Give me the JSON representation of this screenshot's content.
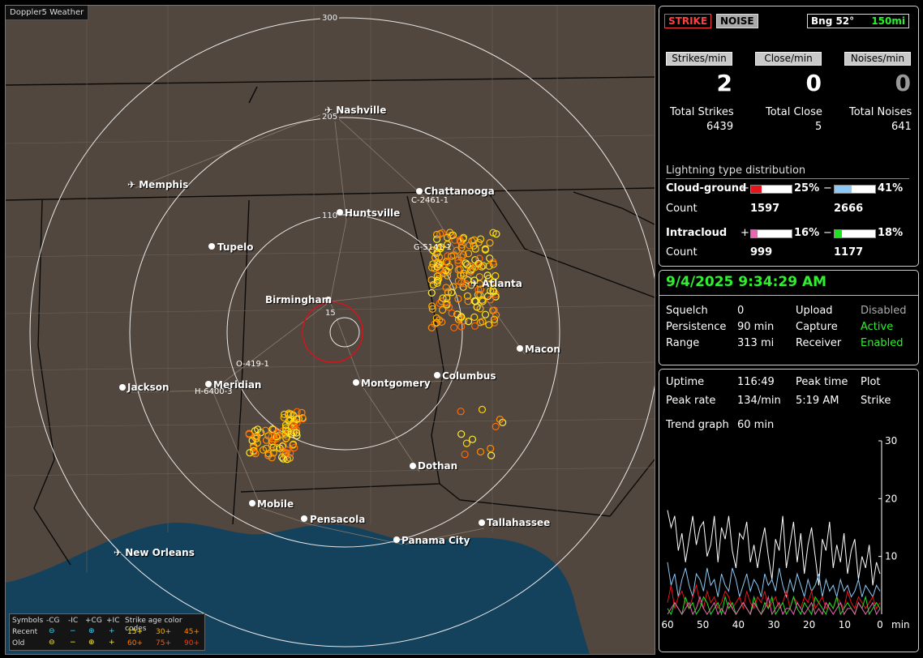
{
  "app_title": "Doppler5 Weather",
  "map": {
    "range_labels": [
      "300",
      "205",
      "110",
      "15"
    ],
    "cities": [
      "Nashville",
      "Memphis",
      "Chattanooga",
      "Huntsville",
      "Tupelo",
      "Atlanta",
      "Birmingham",
      "Macon",
      "Jackson",
      "Meridian",
      "Montgomery",
      "Columbus",
      "Dothan",
      "Mobile",
      "Pensacola",
      "Tallahassee",
      "Panama City",
      "New Orleans"
    ],
    "storm_labels": [
      "C-2461-1",
      "G-5141-1",
      "O-419-1",
      "H-6400-3"
    ]
  },
  "legend": {
    "symbols_title": "Symbols",
    "columns": [
      "-CG",
      "-IC",
      "+CG",
      "+IC"
    ],
    "recent_label": "Recent",
    "old_label": "Old",
    "age_title": "Strike age color codes",
    "recent_ages": [
      "15+",
      "30+",
      "45+"
    ],
    "old_ages": [
      "60+",
      "75+",
      "90+"
    ]
  },
  "status": {
    "strike_tab": "STRIKE",
    "noise_tab": "NOISE",
    "bearing": "Bng 52°",
    "range": "150mi",
    "strikes_min_label": "Strikes/min",
    "close_min_label": "Close/min",
    "noises_min_label": "Noises/min",
    "strikes_min": "2",
    "close_min": "0",
    "noises_min": "0",
    "total_strikes_label": "Total Strikes",
    "total_close_label": "Total Close",
    "total_noises_label": "Total Noises",
    "total_strikes": "6439",
    "total_close": "5",
    "total_noises": "641"
  },
  "distribution": {
    "title": "Lightning type distribution",
    "cg_label": "Cloud-ground",
    "ic_label": "Intracloud",
    "count_label": "Count",
    "plus": "+",
    "minus": "−",
    "cg_pos_pct": "25%",
    "cg_neg_pct": "41%",
    "cg_pos_count": "1597",
    "cg_neg_count": "2666",
    "ic_pos_pct": "16%",
    "ic_neg_pct": "18%",
    "ic_pos_count": "999",
    "ic_neg_count": "1177",
    "colors": {
      "cg_pos": "#e8141c",
      "cg_neg": "#8ccaf5",
      "ic_pos": "#e868b0",
      "ic_neg": "#22e022"
    },
    "fractions": {
      "cg_pos": 0.25,
      "cg_neg": 0.41,
      "ic_pos": 0.16,
      "ic_neg": 0.18
    }
  },
  "settings": {
    "datetime": "9/4/2025 9:34:29 AM",
    "squelch_label": "Squelch",
    "squelch": "0",
    "persistence_label": "Persistence",
    "persistence": "90 min",
    "range_label": "Range",
    "range": "313 mi",
    "upload_label": "Upload",
    "upload": "Disabled",
    "capture_label": "Capture",
    "capture": "Active",
    "receiver_label": "Receiver",
    "receiver": "Enabled"
  },
  "trend": {
    "uptime_label": "Uptime",
    "uptime": "116:49",
    "peak_time_label": "Peak time",
    "peak_time": "5:19 AM",
    "plot_label": "Plot",
    "peak_rate_label": "Peak rate",
    "peak_rate": "134/min",
    "plot_value": "Strike",
    "trend_graph_label": "Trend graph",
    "trend_graph_value": "60 min"
  },
  "chart_data": {
    "type": "line",
    "x_tick_labels": [
      "60",
      "50",
      "40",
      "30",
      "20",
      "10",
      "0"
    ],
    "x_unit": "min",
    "y_tick_labels": [
      "10",
      "20",
      "30"
    ],
    "ylim": [
      0,
      30
    ],
    "xlim": [
      60,
      0
    ],
    "series": [
      {
        "color": "#ffffff",
        "values": [
          18,
          15,
          17,
          11,
          14,
          9,
          13,
          17,
          12,
          15,
          16,
          10,
          12,
          17,
          9,
          15,
          13,
          17,
          11,
          8,
          14,
          13,
          16,
          9,
          12,
          8,
          12,
          15,
          10,
          6,
          13,
          11,
          17,
          8,
          12,
          16,
          9,
          14,
          7,
          12,
          15,
          10,
          5,
          13,
          11,
          16,
          8,
          12,
          9,
          14,
          7,
          11,
          13,
          6,
          10,
          8,
          12,
          5,
          9,
          7
        ]
      },
      {
        "color": "#8ccaf5",
        "values": [
          9,
          5,
          7,
          3,
          6,
          8,
          5,
          3,
          7,
          6,
          4,
          8,
          5,
          6,
          3,
          7,
          5,
          4,
          8,
          6,
          3,
          5,
          7,
          4,
          6,
          5,
          3,
          7,
          5,
          6,
          4,
          8,
          5,
          3,
          6,
          4,
          7,
          5,
          3,
          6,
          4,
          5,
          7,
          3,
          6,
          4,
          5,
          3,
          6,
          4,
          5,
          3,
          4,
          6,
          3,
          5,
          4,
          3,
          5,
          4
        ]
      },
      {
        "color": "#e8141c",
        "values": [
          2,
          5,
          1,
          3,
          4,
          2,
          1,
          3,
          5,
          2,
          1,
          4,
          2,
          3,
          1,
          2,
          4,
          3,
          1,
          2,
          3,
          1,
          4,
          2,
          1,
          3,
          2,
          4,
          1,
          2,
          3,
          1,
          2,
          4,
          1,
          3,
          2,
          1,
          3,
          2,
          4,
          1,
          2,
          3,
          1,
          2,
          1,
          3,
          2,
          1,
          4,
          2,
          1,
          3,
          2,
          1,
          2,
          3,
          1,
          2
        ]
      },
      {
        "color": "#22e022",
        "values": [
          1,
          0,
          2,
          1,
          0,
          3,
          1,
          2,
          0,
          1,
          3,
          2,
          0,
          1,
          2,
          0,
          3,
          1,
          2,
          0,
          1,
          2,
          1,
          0,
          3,
          1,
          0,
          2,
          1,
          3,
          0,
          1,
          2,
          0,
          1,
          3,
          1,
          0,
          2,
          1,
          0,
          3,
          2,
          1,
          0,
          2,
          1,
          3,
          0,
          1,
          2,
          1,
          0,
          2,
          1,
          3,
          0,
          1,
          2,
          1
        ]
      },
      {
        "color": "#e868b0",
        "values": [
          0,
          1,
          2,
          1,
          0,
          1,
          2,
          0,
          1,
          3,
          1,
          0,
          1,
          2,
          0,
          1,
          0,
          2,
          1,
          0,
          1,
          2,
          1,
          0,
          2,
          1,
          0,
          1,
          3,
          0,
          1,
          2,
          0,
          1,
          1,
          0,
          2,
          1,
          0,
          1,
          2,
          0,
          1,
          0,
          2,
          1,
          0,
          1,
          2,
          0,
          1,
          1,
          0,
          2,
          1,
          0,
          1,
          2,
          0,
          1
        ]
      }
    ]
  }
}
